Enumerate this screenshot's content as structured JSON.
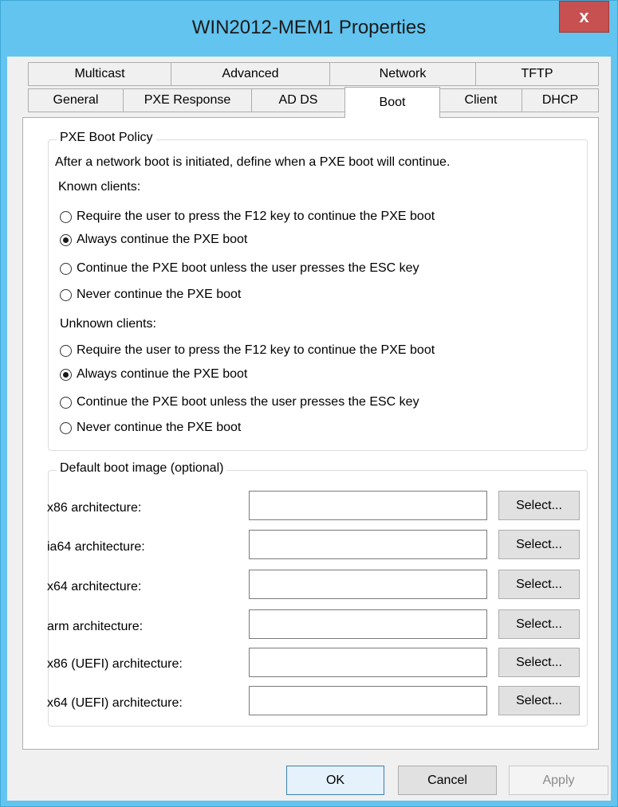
{
  "window": {
    "title": "WIN2012-MEM1 Properties",
    "close_label": "x"
  },
  "tabs": {
    "row1": [
      "Multicast",
      "Advanced",
      "Network",
      "TFTP"
    ],
    "row2": [
      "General",
      "PXE Response",
      "AD DS",
      "Boot",
      "Client",
      "DHCP"
    ],
    "active": "Boot"
  },
  "pxe_policy": {
    "title": "PXE Boot Policy",
    "description": "After a network boot is initiated, define when a PXE boot will continue.",
    "known_label": "Known clients:",
    "unknown_label": "Unknown clients:",
    "options": [
      "Require the user to press the F12 key to continue the PXE boot",
      "Always continue the PXE boot",
      "Continue the PXE boot unless the user presses the ESC key",
      "Never continue the PXE boot"
    ],
    "known_selected": "Always continue the PXE boot",
    "unknown_selected": "Always continue the PXE boot"
  },
  "boot_image": {
    "title": "Default boot image (optional)",
    "select_label": "Select...",
    "rows": [
      {
        "label": "x86 architecture:",
        "value": ""
      },
      {
        "label": "ia64 architecture:",
        "value": ""
      },
      {
        "label": "x64 architecture:",
        "value": ""
      },
      {
        "label": "arm architecture:",
        "value": ""
      },
      {
        "label": "x86 (UEFI) architecture:",
        "value": ""
      },
      {
        "label": "x64 (UEFI) architecture:",
        "value": ""
      }
    ]
  },
  "footer": {
    "ok": "OK",
    "cancel": "Cancel",
    "apply": "Apply"
  }
}
